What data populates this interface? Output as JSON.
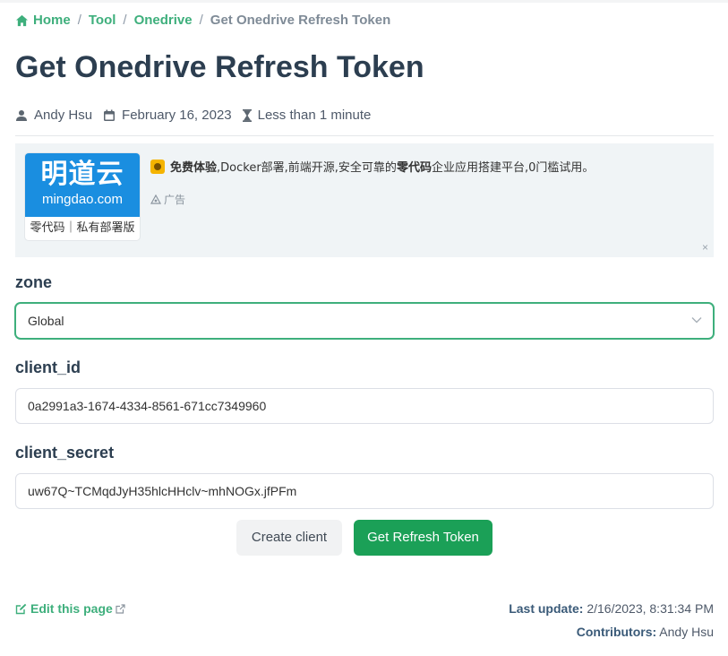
{
  "breadcrumb": {
    "items": [
      "Home",
      "Tool",
      "Onedrive"
    ],
    "current": "Get Onedrive Refresh Token",
    "separator": "/"
  },
  "page": {
    "title": "Get Onedrive Refresh Token"
  },
  "meta": {
    "author": "Andy Hsu",
    "date": "February 16, 2023",
    "reading_time": "Less than 1 minute"
  },
  "ad": {
    "logo_brand": "明道云",
    "logo_domain": "mingdao.com",
    "logo_tag": "零代码｜私有部署版",
    "text_bold1": "免费体验",
    "text_mid": ",Docker部署,前端开源,安全可靠的",
    "text_bold2": "零代码",
    "text_end": "企业应用搭建平台,0门槛试用。",
    "label": "广告",
    "close": "×"
  },
  "form": {
    "zone": {
      "label": "zone",
      "value": "Global"
    },
    "client_id": {
      "label": "client_id",
      "value": "0a2991a3-1674-4334-8561-671cc7349960"
    },
    "client_secret": {
      "label": "client_secret",
      "value": "uw67Q~TCMqdJyH35hlcHHclv~mhNOGx.jfPFm"
    }
  },
  "buttons": {
    "create_client": "Create client",
    "get_refresh_token": "Get Refresh Token"
  },
  "footer": {
    "edit_link": "Edit this page",
    "last_update_label": "Last update:",
    "last_update_value": "2/16/2023, 8:31:34 PM",
    "contributors_label": "Contributors:",
    "contributors_value": "Andy Hsu"
  },
  "colors": {
    "accent": "#3eaf7c",
    "primary_button": "#1ba057",
    "title": "#2c3e50"
  }
}
